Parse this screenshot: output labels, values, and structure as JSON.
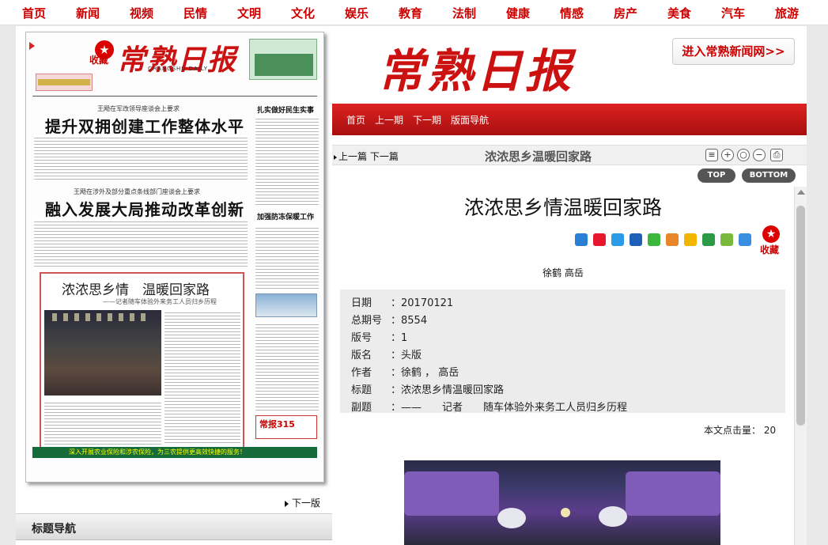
{
  "top_nav": [
    "首页",
    "新闻",
    "视频",
    "民情",
    "文明",
    "文化",
    "娱乐",
    "教育",
    "法制",
    "健康",
    "情感",
    "房产",
    "美食",
    "汽车",
    "旅游"
  ],
  "left": {
    "fav_label": "收藏",
    "fav_icon_glyph": "★",
    "paper": {
      "masthead": "常熟日报",
      "subtitle": "CHANGSHU DAILY",
      "kicker1": "王飏在军改领导座谈会上要求",
      "head1": "提升双拥创建工作整体水平",
      "kicker2": "王飏在涉外及部分重点条线部门座谈会上要求",
      "head2": "融入发展大局推动改革创新",
      "side_head1": "扎实做好民生实事",
      "side_head2": "加强防冻保暖工作",
      "feature_title": "浓浓思乡情　温暖回家路",
      "feature_sub": "——记者随车体验外来务工人员归乡历程",
      "ad315": "常报315",
      "footer": "深入开展农业保险和涉农保险，为三农提供更高效快捷的服务！"
    },
    "next_page": "下一版",
    "title_nav": "标题导航"
  },
  "right": {
    "masthead": "常熟日报",
    "enter_link": "进入常熟新闻网>>",
    "red_nav": [
      "首页",
      "上一期",
      "下一期",
      "版面导航"
    ],
    "toolbar": {
      "prev_next": "上一篇 下一篇",
      "title": "浓浓思乡温暖回家路"
    },
    "top_btn": "TOP",
    "bottom_btn": "BOTTOM",
    "article_title": "浓浓思乡情温暖回家路",
    "fav_label": "收藏",
    "fav_icon_glyph": "★",
    "byline": "徐鹤 高岳",
    "meta": [
      {
        "label": "日期",
        "value": "20170121"
      },
      {
        "label": "总期号",
        "value": "8554"
      },
      {
        "label": "版号",
        "value": "1"
      },
      {
        "label": "版名",
        "value": "头版"
      },
      {
        "label": "作者",
        "value": "徐鹤 ， 高岳"
      },
      {
        "label": "标题",
        "value": "浓浓思乡情温暖回家路"
      },
      {
        "label": "副题",
        "value": "——　　记者　　随车体验外来务工人员归乡历程"
      }
    ],
    "click_count_label": "本文点击量：",
    "click_count": "20"
  },
  "colors": {
    "brand_red": "#cc1111",
    "nav_red": "#c00000",
    "meta_bg": "#ececec"
  },
  "icons": {
    "share": [
      "share-more-icon",
      "weibo-icon",
      "qzone-icon",
      "renren-icon",
      "wechat-icon",
      "tencent-weibo-icon",
      "pengyou-icon",
      "douban-icon",
      "kaixin-icon",
      "count-icon"
    ],
    "tools": [
      "print-preview-icon",
      "zoom-in-icon",
      "zoom-reset-icon",
      "zoom-out-icon",
      "printer-icon"
    ]
  }
}
